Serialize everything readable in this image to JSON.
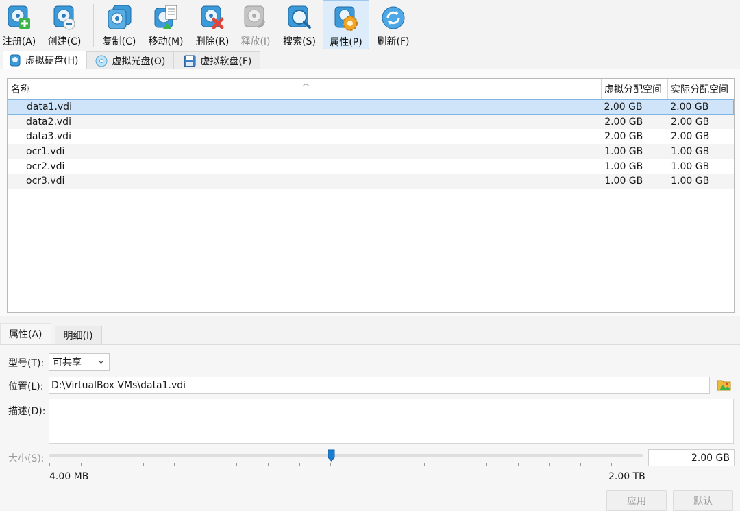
{
  "toolbar": {
    "buttons": [
      {
        "label": "注册(A)"
      },
      {
        "label": "创建(C)"
      },
      {
        "label": "复制(C)"
      },
      {
        "label": "移动(M)"
      },
      {
        "label": "删除(R)"
      },
      {
        "label": "释放(I)"
      },
      {
        "label": "搜索(S)"
      },
      {
        "label": "属性(P)"
      },
      {
        "label": "刷新(F)"
      }
    ]
  },
  "media_tabs": [
    {
      "label": "虚拟硬盘(H)",
      "icon": "hard-disk-icon",
      "active": true
    },
    {
      "label": "虚拟光盘(O)",
      "icon": "optical-disc-icon",
      "active": false
    },
    {
      "label": "虚拟软盘(F)",
      "icon": "floppy-disk-icon",
      "active": false
    }
  ],
  "list": {
    "columns": [
      "名称",
      "虚拟分配空间",
      "实际分配空间"
    ],
    "rows": [
      {
        "name": "data1.vdi",
        "virtual": "2.00 GB",
        "actual": "2.00 GB",
        "selected": true
      },
      {
        "name": "data2.vdi",
        "virtual": "2.00 GB",
        "actual": "2.00 GB"
      },
      {
        "name": "data3.vdi",
        "virtual": "2.00 GB",
        "actual": "2.00 GB"
      },
      {
        "name": "ocr1.vdi",
        "virtual": "1.00 GB",
        "actual": "1.00 GB"
      },
      {
        "name": "ocr2.vdi",
        "virtual": "1.00 GB",
        "actual": "1.00 GB"
      },
      {
        "name": "ocr3.vdi",
        "virtual": "1.00 GB",
        "actual": "1.00 GB"
      }
    ]
  },
  "detail_tabs": [
    "属性(A)",
    "明细(I)"
  ],
  "properties": {
    "type_label": "型号(T):",
    "type_value": "可共享",
    "location_label": "位置(L):",
    "location_value": "D:\\VirtualBox VMs\\data1.vdi",
    "description_label": "描述(D):",
    "description_value": "",
    "size_label": "大小(S):",
    "size_value": "2.00 GB",
    "slider_fraction": 0.475,
    "range_min": "4.00 MB",
    "range_max": "2.00 TB",
    "apply_label": "应用",
    "reset_label": "默认"
  },
  "colors": {
    "accent": "#1a7fd4",
    "selection": "#cfe4f8",
    "disabled_text": "#9b9b9b"
  }
}
